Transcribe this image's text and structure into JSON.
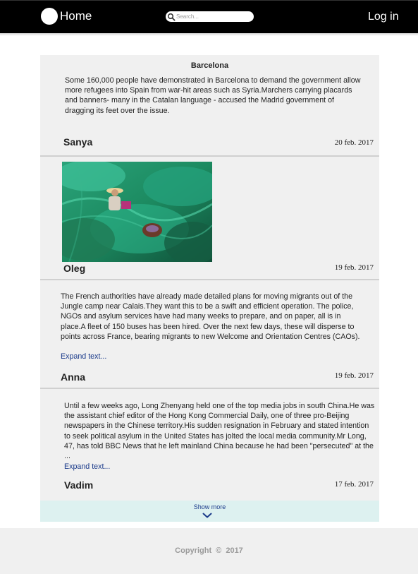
{
  "header": {
    "home_label": "Home",
    "search_placeholder": "Search...",
    "login_label": "Log in"
  },
  "posts": [
    {
      "title": "Barcelona",
      "text": "Some 160,000 people have demonstrated in Barcelona to demand the government allow more refugees into Spain from war-hit areas such as Syria.Marchers carrying placards and banners- many in the Catalan language - accused the Madrid government of dragging its feet over the issue.",
      "author": "Sanya",
      "date": "20 feb. 2017"
    },
    {
      "image_icon": "photo-fishing-nets",
      "author": "Oleg",
      "date": "19 feb. 2017"
    },
    {
      "text": "The French authorities have already made detailed plans for moving migrants out of the Jungle camp near Calais.They want this to be a swift and efficient operation. The police, NGOs and asylum services have had many weeks to prepare, and on paper, all is in place.A fleet of 150 buses has been hired. Over the next few days, these will disperse to points across France, bearing migrants to new Welcome and Orientation Centres (CAOs).",
      "expand_label": "Expand text...",
      "author": "Anna",
      "date": "19 feb. 2017"
    },
    {
      "text": "Until a few weeks ago, Long Zhenyang held one of the top media jobs in south China.He was the assistant chief editor of the Hong Kong Commercial Daily, one of three pro-Beijing newspapers in the Chinese territory.His sudden resignation in February and stated intention to seek political asylum in the United States has jolted the local media community.Mr Long, 47, has told BBC News that he left mainland China because he had been \"persecuted\" at the ...",
      "expand_label": "Expand text...",
      "author": "Vadim",
      "date": "17 feb. 2017"
    }
  ],
  "show_more_label": "Show more",
  "footer": {
    "copyright": "Copyright  © 2017"
  },
  "colors": {
    "header_bg": "#000000",
    "feed_bg": "#f0f0f0",
    "link": "#1a3a8a",
    "show_more_bg": "#ddf1f0"
  }
}
